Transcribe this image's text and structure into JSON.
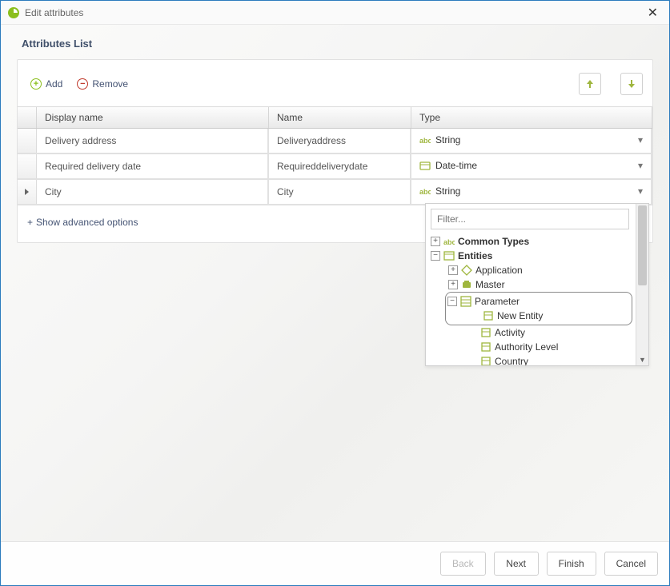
{
  "window": {
    "title": "Edit attributes"
  },
  "page": {
    "heading": "Attributes List"
  },
  "toolbar": {
    "add_label": "Add",
    "remove_label": "Remove"
  },
  "grid": {
    "headers": {
      "display_name": "Display name",
      "name": "Name",
      "type": "Type"
    },
    "rows": [
      {
        "display_name": "Delivery address",
        "name": "Deliveryaddress",
        "type": "String",
        "type_kind": "string",
        "selected": false
      },
      {
        "display_name": "Required delivery date",
        "name": "Requireddeliverydate",
        "type": "Date-time",
        "type_kind": "datetime",
        "selected": false
      },
      {
        "display_name": "City",
        "name": "City",
        "type": "String",
        "type_kind": "string",
        "selected": true
      }
    ]
  },
  "advanced_label": "Show advanced options",
  "dropdown": {
    "filter_placeholder": "Filter...",
    "common_types": "Common Types",
    "entities": "Entities",
    "application": "Application",
    "master": "Master",
    "parameter": "Parameter",
    "new_entity": "New Entity",
    "activity": "Activity",
    "authority_level": "Authority Level",
    "country": "Country"
  },
  "footer": {
    "back": "Back",
    "next": "Next",
    "finish": "Finish",
    "cancel": "Cancel"
  }
}
